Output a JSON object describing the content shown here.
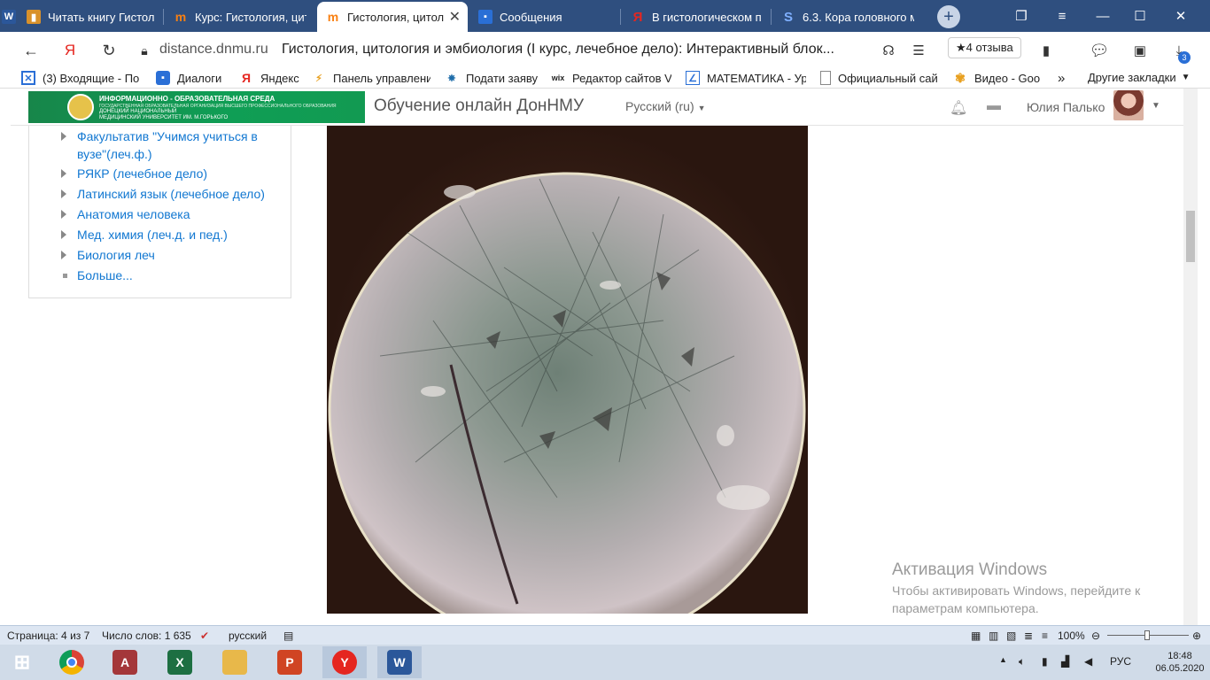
{
  "tabs": [
    {
      "title": "Читать книгу Гистоло",
      "icon": "book-icon",
      "color": "#d8912b"
    },
    {
      "title": "Курс: Гистология, цит",
      "icon": "moodle-icon",
      "color": "#f98012"
    },
    {
      "title": "Гистология, цитол",
      "icon": "moodle-icon",
      "color": "#f98012",
      "active": true
    },
    {
      "title": "Сообщения",
      "icon": "chat-icon",
      "color": "#2a6fd6"
    },
    {
      "title": "В гистологическом пр",
      "icon": "yandex-icon",
      "color": "#e52620"
    },
    {
      "title": "6.3. Кора головного м",
      "icon": "s-icon",
      "color": "#3b7bd4"
    }
  ],
  "address": {
    "domain": "distance.dnmu.ru",
    "title": "Гистология, цитология и эмбиология (I курс, лечебное дело): Интерактивный блок...",
    "reviews": "★4 отзыва",
    "downloads_badge": "3"
  },
  "bookmarks": [
    {
      "label": "(3) Входящие - По",
      "icon": "mail-icon"
    },
    {
      "label": "Диалоги",
      "icon": "chat-icon"
    },
    {
      "label": "Яндекс",
      "icon": "yandex-icon"
    },
    {
      "label": "Панель управлени",
      "icon": "panel-icon"
    },
    {
      "label": "Подати заяву",
      "icon": "emblem-icon"
    },
    {
      "label": "Редактор сайтов V",
      "icon": "wix-icon"
    },
    {
      "label": "МАТЕМАТИКА - Ур",
      "icon": "math-icon"
    },
    {
      "label": "Официальный сай",
      "icon": "page-icon"
    },
    {
      "label": "Видео - Goo",
      "icon": "pinwheel-icon"
    },
    {
      "label": "Другие закладки",
      "icon": "folder-icon"
    }
  ],
  "header": {
    "logo_line1": "ИНФОРМАЦИОННО - ОБРАЗОВАТЕЛЬНАЯ СРЕДА",
    "logo_line2": "ГОСУДАРСТВЕННАЯ ОБРАЗОВАТЕЛЬНАЯ ОРГАНИЗАЦИЯ ВЫСШЕГО ПРОФЕССИОНАЛЬНОГО ОБРАЗОВАНИЯ",
    "logo_line3": "ДОНЕЦКИЙ НАЦИОНАЛЬНЫЙ",
    "logo_line4": "МЕДИЦИНСКИЙ УНИВЕРСИТЕТ ИМ. М.ГОРЬКОГО",
    "site_title": "Обучение онлайн ДонНМУ",
    "language": "Русский (ru)",
    "user": "Юлия Палько"
  },
  "courses": [
    {
      "label_line1": "Факультатив \"Учимся учиться в",
      "label_line2": "вузе\"(леч.ф.)",
      "marker": "arrow"
    },
    {
      "label_line1": "РЯКР (лечебное дело)",
      "label_line2": "",
      "marker": "arrow"
    },
    {
      "label_line1": "Латинский язык (лечебное дело)",
      "label_line2": "",
      "marker": "arrow"
    },
    {
      "label_line1": "Анатомия человека",
      "label_line2": "",
      "marker": "arrow"
    },
    {
      "label_line1": "Мед. химия (леч.д. и пед.)",
      "label_line2": "",
      "marker": "arrow"
    },
    {
      "label_line1": "Биология леч",
      "label_line2": "",
      "marker": "arrow"
    },
    {
      "label_line1": "Больше...",
      "label_line2": "",
      "marker": "square"
    }
  ],
  "activation": {
    "title": "Активация Windows",
    "text": "Чтобы активировать Windows, перейдите к параметрам компьютера."
  },
  "statusbar": {
    "page": "Страница: 4 из 7",
    "words": "Число слов: 1 635",
    "language": "русский",
    "zoom": "100%"
  },
  "taskbar": {
    "apps": [
      {
        "name": "start-button",
        "icon": "windows-icon"
      },
      {
        "name": "chrome",
        "icon": "chrome-icon",
        "color": "#db4437"
      },
      {
        "name": "access",
        "icon": "access-icon",
        "color": "#a4373a",
        "letter": "A"
      },
      {
        "name": "excel",
        "icon": "excel-icon",
        "color": "#1d6f42",
        "letter": "X"
      },
      {
        "name": "explorer",
        "icon": "folder-icon",
        "color": "#e8b84a"
      },
      {
        "name": "powerpoint",
        "icon": "powerpoint-icon",
        "color": "#d04423",
        "letter": "P"
      },
      {
        "name": "yandex-browser",
        "icon": "yandex-icon",
        "color": "#e52620",
        "letter": "Y"
      },
      {
        "name": "word",
        "icon": "word-icon",
        "color": "#2b579a",
        "letter": "W"
      }
    ],
    "lang": "РУС",
    "time": "18:48",
    "date": "06.05.2020"
  }
}
